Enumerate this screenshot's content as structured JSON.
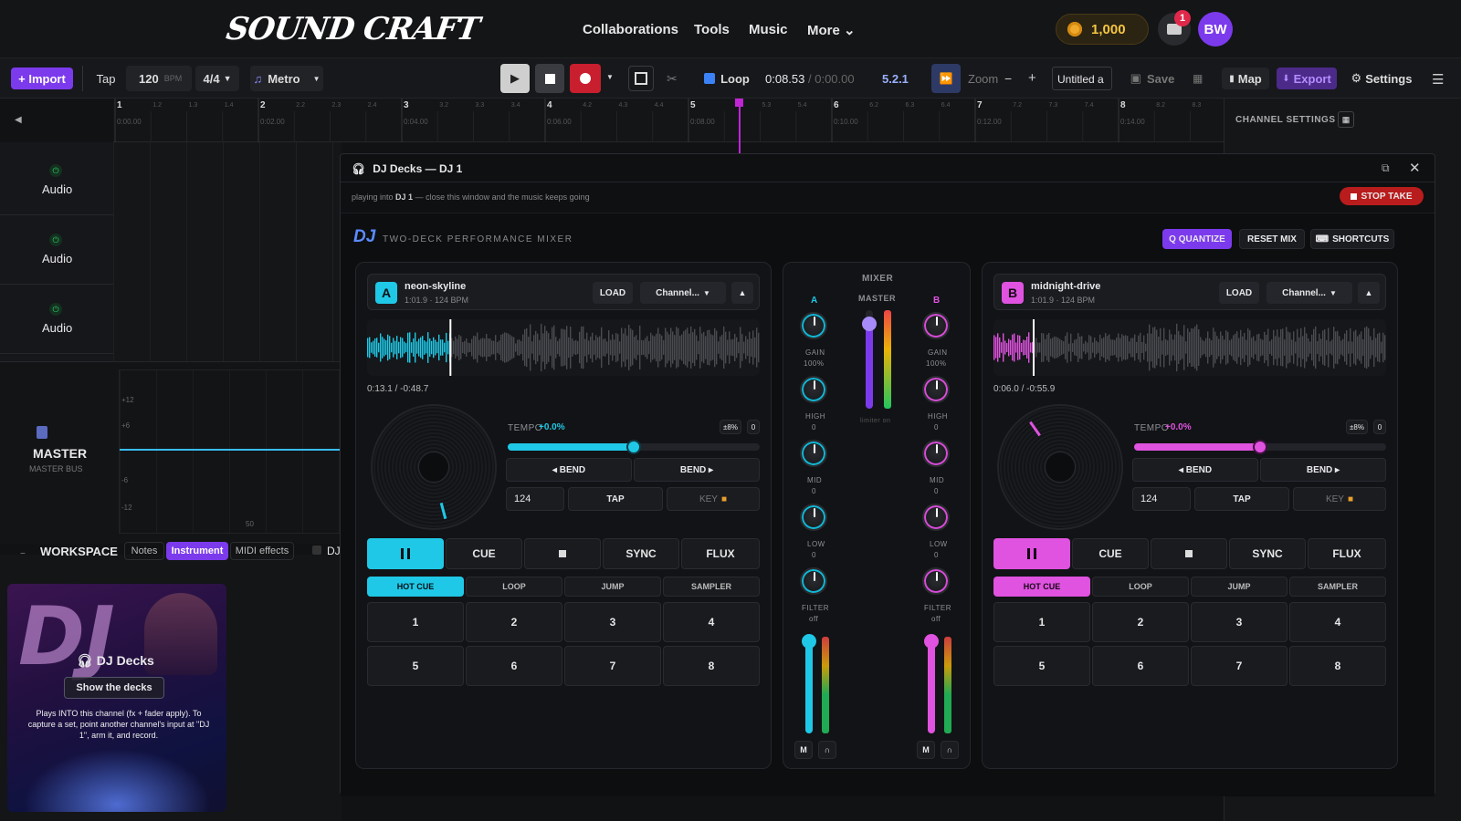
{
  "nav": {
    "logo": "SOUND CRAFT",
    "links": [
      "Collaborations",
      "Tools",
      "Music",
      "More"
    ],
    "more_chev": "⌄",
    "coins": "1,000",
    "mail_badge": "1",
    "avatar": "BW"
  },
  "toolbar": {
    "import": "+ Import",
    "tap": "Tap",
    "bpm": "120",
    "bpm_unit": "BPM",
    "timesig": "4/4",
    "metro": "Metro",
    "loop": "Loop",
    "time": "0:08.53",
    "time_total": "/ 0:00.00",
    "version": "5.2.1",
    "zoom": "Zoom",
    "zoom_minus": "−",
    "zoom_plus": "+",
    "project": "Untitled a",
    "save": "Save",
    "map": "Map",
    "export": "Export",
    "settings": "Settings"
  },
  "ruler": {
    "bars": [
      "1",
      "2",
      "3",
      "4",
      "5",
      "6",
      "7",
      "8"
    ],
    "subs": [
      "1.2",
      "1.3",
      "1.4",
      "2.2",
      "2.3",
      "2.4",
      "3.2",
      "3.3",
      "3.4",
      "4.2",
      "4.3",
      "4.4",
      "5.3",
      "5.4",
      "6.2",
      "6.3",
      "6.4",
      "7.2",
      "7.3",
      "7.4",
      "8.2",
      "8.3"
    ],
    "times": [
      "0:00.00",
      "0:02.00",
      "0:04.00",
      "0:06.00",
      "0:08.00",
      "0:10.00",
      "0:12.00",
      "0:14.00"
    ],
    "playhead_bar": 5.35
  },
  "tracks": [
    {
      "label": "Audio"
    },
    {
      "label": "Audio"
    },
    {
      "label": "Audio"
    }
  ],
  "master": {
    "title": "MASTER",
    "sub": "MASTER BUS",
    "db": [
      "+12",
      "+6",
      "-6",
      "-12"
    ],
    "tick": "50"
  },
  "workspace": {
    "title": "WORKSPACE",
    "tabs": [
      "Notes",
      "Instrument",
      "MIDI effects"
    ],
    "active_tab": "Instrument",
    "dj_tab": "DJ"
  },
  "card": {
    "big": "DJ",
    "title": "DJ Decks",
    "button": "Show the decks",
    "desc": "Plays INTO this channel (fx + fader apply). To capture a set, point another channel's input at \"DJ 1\", arm it, and record."
  },
  "right_panel": {
    "title": "CHANNEL SETTINGS"
  },
  "modal": {
    "title": "DJ Decks — DJ 1",
    "subtitle_pre": "playing into ",
    "subtitle_bold": "DJ 1",
    "subtitle_post": " — close this window and the music keeps going",
    "stop_take": "STOP TAKE",
    "brand": "DJ",
    "brand_sub": "TWO-DECK PERFORMANCE MIXER",
    "quantize": "Q QUANTIZE",
    "reset": "RESET MIX",
    "shortcuts": "SHORTCUTS"
  },
  "deck_a": {
    "letter": "A",
    "name": "neon-skyline",
    "meta": "1:01.9 · 124 BPM",
    "load": "LOAD",
    "channel": "Channel...",
    "time": "0:13.1 / -0:48.7",
    "tempo_label": "TEMPO",
    "tempo_value": "+0.0%",
    "range": "±8%",
    "zero": "0",
    "tempo_pos": 0.5,
    "progress": 0.21,
    "bend_left": "◂ BEND",
    "bend_right": "BEND ▸",
    "bpm": "124",
    "tap": "TAP",
    "key": "KEY",
    "cue": "CUE",
    "sync": "SYNC",
    "flux": "FLUX",
    "modes": [
      "HOT CUE",
      "LOOP",
      "JUMP",
      "SAMPLER"
    ],
    "pads": [
      "1",
      "2",
      "3",
      "4",
      "5",
      "6",
      "7",
      "8"
    ],
    "color": "#1fc8e6"
  },
  "deck_b": {
    "letter": "B",
    "name": "midnight-drive",
    "meta": "1:01.9 · 124 BPM",
    "load": "LOAD",
    "channel": "Channel...",
    "time": "0:06.0 / -0:55.9",
    "tempo_label": "TEMPO",
    "tempo_value": "+0.0%",
    "range": "±8%",
    "zero": "0",
    "tempo_pos": 0.5,
    "progress": 0.1,
    "bend_left": "◂ BEND",
    "bend_right": "BEND ▸",
    "bpm": "124",
    "tap": "TAP",
    "key": "KEY",
    "cue": "CUE",
    "sync": "SYNC",
    "flux": "FLUX",
    "modes": [
      "HOT CUE",
      "LOOP",
      "JUMP",
      "SAMPLER"
    ],
    "pads": [
      "1",
      "2",
      "3",
      "4",
      "5",
      "6",
      "7",
      "8"
    ],
    "color": "#e052e0"
  },
  "mixer": {
    "title": "MIXER",
    "a": "A",
    "b": "B",
    "master": "MASTER",
    "limiter": "limiter on",
    "gain": "GAIN",
    "gain_val": "100%",
    "high": "HIGH",
    "mid": "MID",
    "low": "LOW",
    "zero": "0",
    "filter": "FILTER",
    "filter_val": "off",
    "m": "M",
    "master_level": 0.86,
    "fader_a": 0.95,
    "fader_b": 0.95
  }
}
